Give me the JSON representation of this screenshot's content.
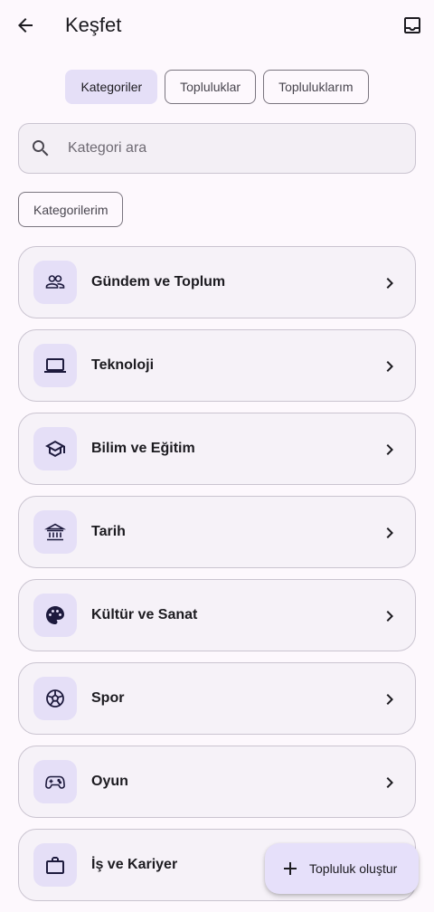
{
  "app_bar": {
    "title": "Keşfet",
    "back_icon": "arrow-back-icon",
    "inbox_icon": "inbox-icon"
  },
  "tabs": [
    {
      "label": "Kategoriler",
      "active": true
    },
    {
      "label": "Topluluklar",
      "active": false
    },
    {
      "label": "Topluluklarım",
      "active": false
    }
  ],
  "search": {
    "placeholder": "Kategori ara",
    "value": "",
    "icon": "search-icon"
  },
  "my_categories_chip": "Kategorilerim",
  "categories": [
    {
      "label": "Gündem ve Toplum",
      "icon": "people-icon"
    },
    {
      "label": "Teknoloji",
      "icon": "laptop-icon"
    },
    {
      "label": "Bilim ve Eğitim",
      "icon": "school-icon"
    },
    {
      "label": "Tarih",
      "icon": "museum-icon"
    },
    {
      "label": "Kültür ve Sanat",
      "icon": "palette-icon"
    },
    {
      "label": "Spor",
      "icon": "soccer-ball-icon"
    },
    {
      "label": "Oyun",
      "icon": "gamepad-icon"
    },
    {
      "label": "İş ve Kariyer",
      "icon": "briefcase-icon"
    }
  ],
  "fab": {
    "label": "Topluluk oluştur",
    "icon": "add-icon"
  },
  "colors": {
    "background": "#fdf8fd",
    "accent_container": "#e5dff7",
    "icon_color": "#1d1a3d",
    "outline": "#cac4d0"
  }
}
